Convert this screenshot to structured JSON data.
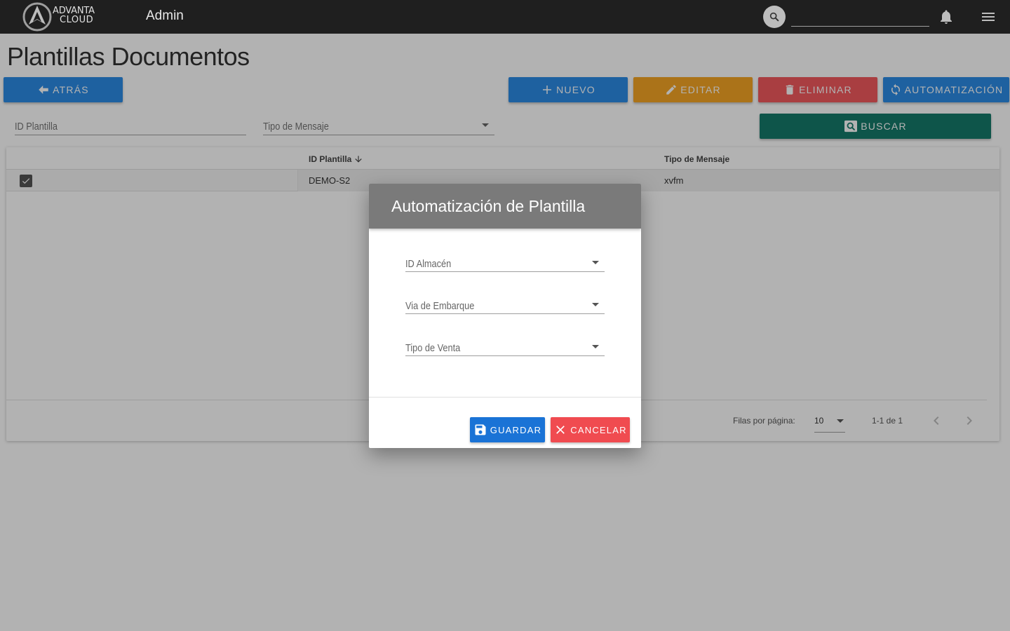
{
  "topbar": {
    "logo_line1": "ADVANTA",
    "logo_line2": "CLOUD",
    "title": "Admin",
    "search_placeholder": ""
  },
  "page": {
    "title": "Plantillas Documentos"
  },
  "toolbar": {
    "back_label": "ATRÁS",
    "new_label": "NUEVO",
    "edit_label": "EDITAR",
    "delete_label": "ELIMINAR",
    "automation_label": "AUTOMATIZACIÓN",
    "search_label": "BUSCAR"
  },
  "filters": {
    "id_label": "ID Plantilla",
    "type_label": "Tipo de Mensaje"
  },
  "table": {
    "columns": [
      "ID Plantilla",
      "Tipo de Mensaje"
    ],
    "rows": [
      {
        "checked": true,
        "id": "DEMO-S2",
        "type": "xvfm"
      }
    ],
    "rows_per_page_label": "Filas por página:",
    "rows_per_page_value": "10",
    "range_label": "1-1 de 1"
  },
  "dialog": {
    "title": "Automatización de Plantilla",
    "fields": [
      "ID Almacén",
      "Via de Embarque",
      "Tipo de Venta"
    ],
    "save_label": "GUARDAR",
    "cancel_label": "CANCELAR"
  },
  "colors": {
    "topbar": "#1f1f1f",
    "primary": "#2c8be6",
    "warning": "#f5a524",
    "danger": "#f2595d",
    "success": "#157a6a",
    "dialog_header": "#7a7a7a"
  }
}
